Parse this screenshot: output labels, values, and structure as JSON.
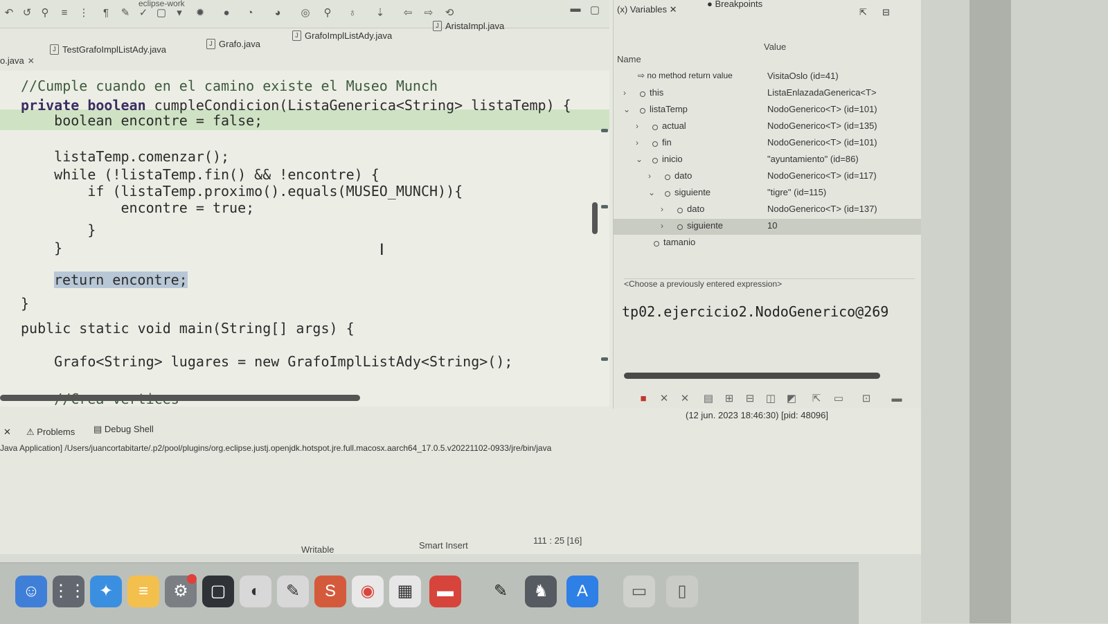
{
  "window": {
    "app_title": "eclipse-work"
  },
  "editor_tabs": [
    {
      "label": "o.java",
      "closable": true
    },
    {
      "label": "TestGrafoImplListAdy.java",
      "closable": false
    },
    {
      "label": "Grafo.java",
      "closable": false
    },
    {
      "label": "GrafoImplListAdy.java",
      "closable": false
    },
    {
      "label": "AristaImpl.java",
      "closable": false
    }
  ],
  "code": {
    "line1": "//Cumple cuando en el camino existe el Museo Munch",
    "line2a": "private boolean",
    "line2b": " cumpleCondicion(ListaGenerica<String> listaTemp) {",
    "line3": "    boolean encontre = false;",
    "line4": "    listaTemp.comenzar();",
    "line5": "    while (!listaTemp.fin() && !encontre) {",
    "line6": "        if (listaTemp.proximo().equals(MUSEO_MUNCH)){",
    "line7": "            encontre = true;",
    "line8": "        }",
    "line9": "    }",
    "line10": "return encontre;",
    "line11": "}",
    "line12": "public static void main(String[] args) {",
    "line13": "    Grafo<String> lugares = new GrafoImplListAdy<String>();",
    "line14": "    //Crea vertices"
  },
  "variables": {
    "tab_variables": "Variables",
    "tab_breakpoints": "Breakpoints",
    "col_name": "Name",
    "col_value": "Value",
    "rows": [
      {
        "name": "no method return value",
        "value": "VisitaOslo (id=41)"
      },
      {
        "name": "this",
        "value": "ListaEnlazadaGenerica<T>"
      },
      {
        "name": "listaTemp",
        "value": "NodoGenerico<T> (id=101)"
      },
      {
        "name": "actual",
        "value": "NodoGenerico<T> (id=135)"
      },
      {
        "name": "fin",
        "value": "NodoGenerico<T> (id=101)"
      },
      {
        "name": "inicio",
        "value": "\"ayuntamiento\" (id=86)"
      },
      {
        "name": "dato",
        "value": "NodoGenerico<T> (id=117)"
      },
      {
        "name": "siguiente",
        "value": "\"tigre\" (id=115)"
      },
      {
        "name": "dato",
        "value": "NodoGenerico<T> (id=137)"
      },
      {
        "name": "siguiente",
        "value": "10"
      },
      {
        "name": "tamanio",
        "value": ""
      }
    ],
    "expression_placeholder": "<Choose a previously entered expression>",
    "detail_value": "tp02.ejercicio2.NodoGenerico@269"
  },
  "bottom_tabs": {
    "problems": "Problems",
    "debug_shell": "Debug Shell"
  },
  "console": {
    "path_tail": "(12 jun. 2023 18:46:30) [pid: 48096]",
    "line": "Java Application] /Users/juancortabitarte/.p2/pool/plugins/org.eclipse.justj.openjdk.hotspot.jre.full.macosx.aarch64_17.0.5.v20221102-0933/jre/bin/java"
  },
  "status_bar": {
    "writable": "Writable",
    "insert_mode": "Smart Insert",
    "position": "111 : 25 [16]"
  },
  "dock_apps": [
    "finder-icon",
    "launchpad-icon",
    "safari-icon",
    "notes-icon",
    "calendar-icon",
    "terminal-icon",
    "chrome-icon"
  ]
}
